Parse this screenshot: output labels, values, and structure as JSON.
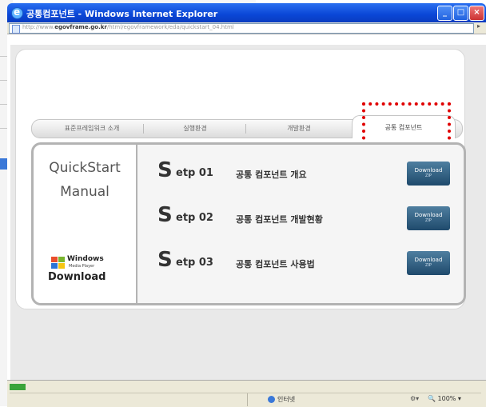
{
  "window": {
    "title": "공통컴포넌트 - Windows Internet Explorer",
    "controls": {
      "minimize": "_",
      "maximize": "□",
      "close": "×"
    }
  },
  "addressbar": {
    "url_prefix": "http://www.",
    "url_domain": "egovframe.go.kr",
    "url_path": "/html/egovframework/eda/quickstart_04.html",
    "go_icon": "go-icon"
  },
  "tabs": [
    {
      "label": "표준프레임워크 소개",
      "active": false
    },
    {
      "label": "실행환경",
      "active": false
    },
    {
      "label": "개발환경",
      "active": false
    },
    {
      "label": "공통 컴포넌트",
      "active": true
    }
  ],
  "quickstart": {
    "line1": "QuickStart",
    "line2": "Manual",
    "wmp_brand": "Windows",
    "wmp_sub": "Media Player",
    "wmp_download": "Download"
  },
  "steps": [
    {
      "big": "S",
      "rest": "etp 01",
      "text": "공통 컴포넌트 개요",
      "button": "Download",
      "button_sub": "ZIP"
    },
    {
      "big": "S",
      "rest": "etp 02",
      "text": "공통 컴포넌트 개발현황",
      "button": "Download",
      "button_sub": "ZIP"
    },
    {
      "big": "S",
      "rest": "etp 03",
      "text": "공통 컴포넌트 사용법",
      "button": "Download",
      "button_sub": "ZIP"
    }
  ],
  "statusbar": {
    "zone": "인터넷",
    "zoom": "100%",
    "zoom_prefix": "🔍"
  },
  "colors": {
    "titlebar": "#0a46d6",
    "highlight": "#e00000",
    "download_button": "#1f4a6c"
  }
}
